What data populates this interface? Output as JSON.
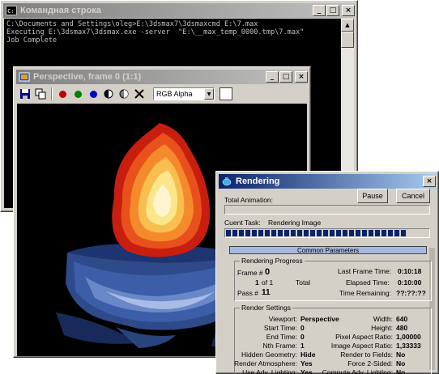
{
  "cmd_window": {
    "title": "Командная строка",
    "lines": [
      "C:\\Documents and Settings\\oleg>E:\\3dsmax7\\3dsmaxcmd E:\\7.max",
      "Executing E:\\3dsmax7\\3dsmax.exe -server  \"E:\\__max_temp_0000.tmp\\7.max\"",
      "Job Complete"
    ],
    "buttons": {
      "minimize": "_",
      "maximize": "□",
      "close": "×"
    }
  },
  "frame_window": {
    "title": "Perspective, frame 0 (1:1)",
    "channel_dropdown": "RGB Alpha",
    "toolbar_colors": {
      "red": "#c00000",
      "green": "#008000",
      "blue": "#0000c0"
    },
    "buttons": {
      "minimize": "_",
      "maximize": "□",
      "close": "×"
    }
  },
  "render_dialog": {
    "title": "Rendering",
    "total_animation_label": "Total Animation:",
    "pause_label": "Pause",
    "cancel_label": "Cancel",
    "current_task_label": "Cuent Task:",
    "current_task_value": "Rendering Image",
    "current_task_progress": 0.9,
    "close_button": "×",
    "common_parameters": "Common Parameters",
    "rendering_progress": {
      "title": "Rendering Progress",
      "frame_label": "Frame #",
      "frame_value": "0",
      "last_frame_time_label": "Last Frame Time:",
      "last_frame_time_value": "0:10:18",
      "count_value": "1",
      "of_label": "of 1",
      "total_label": "Total",
      "elapsed_label": "Elapsed Time:",
      "elapsed_value": "0:10:00",
      "pass_label": "Pass #",
      "pass_value": "11",
      "remaining_label": "Time Remaining:",
      "remaining_value": "??:??:??"
    },
    "render_settings": {
      "title": "Render Settings",
      "rows": [
        {
          "l1": "Viewport:",
          "v1": "Perspective",
          "l2": "Width:",
          "v2": "640"
        },
        {
          "l1": "Start Time:",
          "v1": "0",
          "l2": "Height:",
          "v2": "480"
        },
        {
          "l1": "End Time:",
          "v1": "0",
          "l2": "Pixel Aspect Ratio:",
          "v2": "1,00000"
        },
        {
          "l1": "Nth Frame:",
          "v1": "1",
          "l2": "Image Aspect Ratio:",
          "v2": "1,33333"
        },
        {
          "l1": "Hidden Geometry:",
          "v1": "Hide",
          "l2": "Render to Fields:",
          "v2": "No"
        },
        {
          "l1": "Render Atmosphere:",
          "v1": "Yes",
          "l2": "Force 2-Sided:",
          "v2": "No"
        },
        {
          "l1": "Use Adv. Lighting:",
          "v1": "Yes",
          "l2": "Compute Adv. Lighting:",
          "v2": "No"
        }
      ]
    }
  }
}
